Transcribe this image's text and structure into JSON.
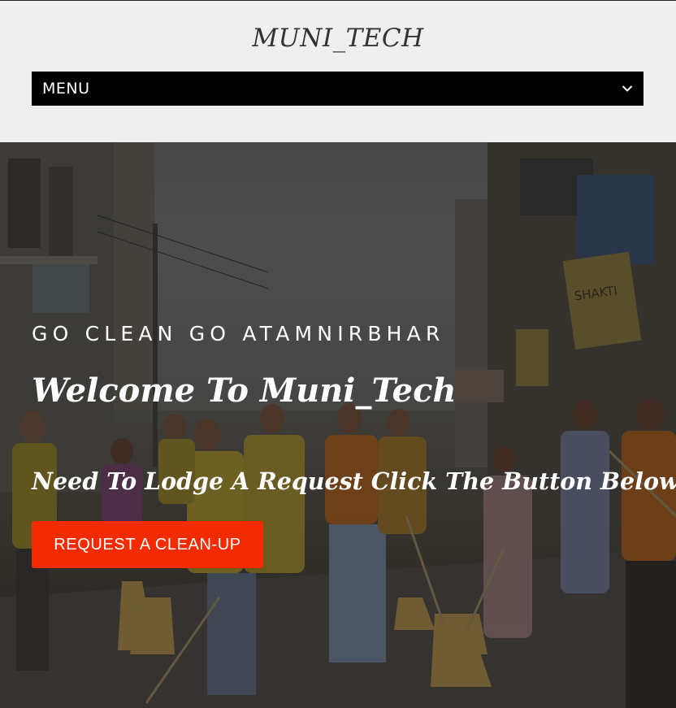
{
  "site": {
    "title": "MUNI_TECH"
  },
  "nav": {
    "menu_label": "MENU"
  },
  "hero": {
    "tagline": "GO CLEAN GO ATAMNIRBHAR",
    "heading": "Welcome To Muni_Tech",
    "subheading": "Need To Lodge A Request Click The Button Below",
    "cta_label": "REQUEST A CLEAN-UP",
    "shop_sign": "SHAKTI"
  },
  "colors": {
    "accent": "#f52b00",
    "menu_bg": "#000000",
    "header_bg": "#efefef"
  }
}
